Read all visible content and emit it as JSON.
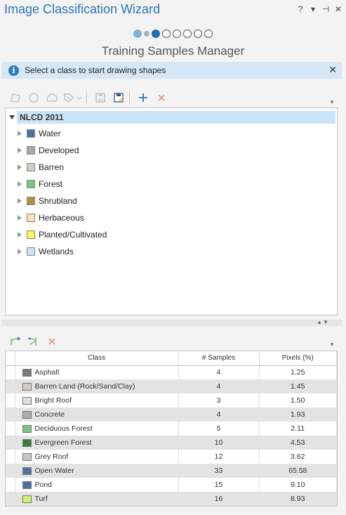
{
  "window": {
    "title": "Image Classification Wizard",
    "controls": [
      "?",
      "▾",
      "⊣",
      "✕"
    ]
  },
  "wizard": {
    "step_title": "Training Samples Manager",
    "steps": [
      {
        "state": "done"
      },
      {
        "state": "minor"
      },
      {
        "state": "current"
      },
      {
        "state": "todo"
      },
      {
        "state": "todo"
      },
      {
        "state": "todo"
      },
      {
        "state": "todo"
      },
      {
        "state": "todo"
      }
    ]
  },
  "info_bar": {
    "icon": "i",
    "text": "Select a class to start drawing shapes",
    "close": "✕"
  },
  "schema_tree": {
    "root": "NLCD 2011",
    "classes": [
      {
        "label": "Water",
        "color": "#4f6fa3"
      },
      {
        "label": "Developed",
        "color": "#a8a8a8"
      },
      {
        "label": "Barren",
        "color": "#d2cbc2"
      },
      {
        "label": "Forest",
        "color": "#7cc47e"
      },
      {
        "label": "Shrubland",
        "color": "#b09332"
      },
      {
        "label": "Herbaceous",
        "color": "#fbe3ae"
      },
      {
        "label": "Planted/Cultivated",
        "color": "#fbf45a"
      },
      {
        "label": "Wetlands",
        "color": "#cde4f6"
      }
    ]
  },
  "samples_table": {
    "headers": {
      "class": "Class",
      "samples": "# Samples",
      "pixels": "Pixels (%)"
    },
    "rows": [
      {
        "class": "Asphalt",
        "color": "#7a7a7a",
        "samples": "4",
        "pixels": "1.25"
      },
      {
        "class": "Barren Land (Rock/Sand/Clay)",
        "color": "#d2cbc2",
        "samples": "4",
        "pixels": "1.45"
      },
      {
        "class": "Bright Roof",
        "color": "#dedede",
        "samples": "3",
        "pixels": "1.50"
      },
      {
        "class": "Concrete",
        "color": "#acacac",
        "samples": "4",
        "pixels": "1.93"
      },
      {
        "class": "Deciduous Forest",
        "color": "#7cc47e",
        "samples": "5",
        "pixels": "2.11"
      },
      {
        "class": "Evergreen Forest",
        "color": "#3a7a3f",
        "samples": "10",
        "pixels": "4.53"
      },
      {
        "class": "Grey Roof",
        "color": "#c6c6c6",
        "samples": "12",
        "pixels": "3.62"
      },
      {
        "class": "Open Water",
        "color": "#4f6fa3",
        "samples": "33",
        "pixels": "65.58"
      },
      {
        "class": "Pond",
        "color": "#4f6fa3",
        "samples": "15",
        "pixels": "9.10"
      },
      {
        "class": "Turf",
        "color": "#c8f56c",
        "samples": "16",
        "pixels": "8.93"
      }
    ]
  },
  "colors": {
    "accent": "#2e74b5",
    "info_bar": "#d6e8f7",
    "selected_row": "#cce4f7"
  }
}
